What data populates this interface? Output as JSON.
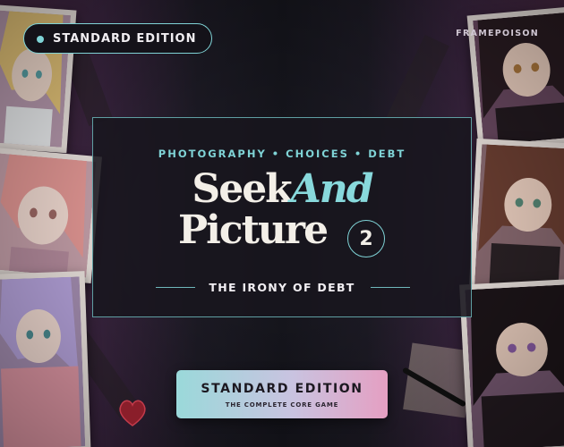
{
  "edition_badge": {
    "label": "STANDARD EDITION"
  },
  "publisher": "FRAMEPOISON",
  "card": {
    "tagline": "PHOTOGRAPHY • CHOICES • DEBT",
    "title_part1": "Seek",
    "title_part2": "And",
    "title_line2": "Picture",
    "number": "2",
    "subtitle": "THE IRONY OF DEBT"
  },
  "cta": {
    "label": "STANDARD EDITION",
    "sublabel": "THE COMPLETE CORE GAME"
  },
  "colors": {
    "accent_teal": "#7fd3d6",
    "cta_gradient_start": "#9ad9da",
    "cta_gradient_end": "#e59fc2",
    "card_bg": "#18161e"
  }
}
